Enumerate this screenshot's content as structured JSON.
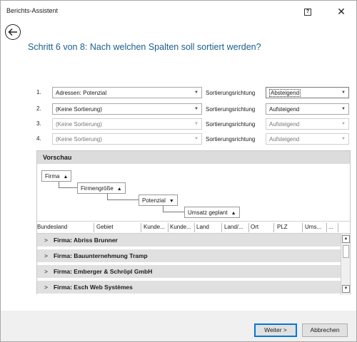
{
  "window": {
    "title": "Berichts-Assistent"
  },
  "heading": "Schritt 6 von 8: Nach welchen Spalten soll sortiert werden?",
  "sort_label": "Sortierungsrichtung",
  "sort_rows": [
    {
      "num": "1.",
      "column": "Adressen: Potenzial",
      "direction": "Absteigend"
    },
    {
      "num": "2.",
      "column": "(Keine Sortierung)",
      "direction": "Aufsteigend"
    },
    {
      "num": "3.",
      "column": "(Keine Sortierung)",
      "direction": "Aufsteigend"
    },
    {
      "num": "4.",
      "column": "(Keine Sortierung)",
      "direction": "Aufsteigend"
    }
  ],
  "preview": {
    "title": "Vorschau",
    "group_chips": [
      "Firma",
      "Firmengröße",
      "Potenzial",
      "Umsatz geplant"
    ],
    "columns": [
      "Bundesland",
      "Gebiet",
      "Kunde...",
      "Kunde...",
      "Land",
      "Land/...",
      "Ort",
      "PLZ",
      "Ums...",
      "..."
    ],
    "groups": [
      "Firma: Abriss Brunner",
      "Firma: Bauunternehmung Tramp",
      "Firma: Emberger & Schröpl GmbH",
      "Firma: Esch Web Systèmes"
    ]
  },
  "buttons": {
    "next": "Weiter >",
    "cancel": "Abbrechen"
  },
  "icons": {
    "back": "back-arrow-icon",
    "help": "help-icon",
    "close": "close-icon"
  }
}
